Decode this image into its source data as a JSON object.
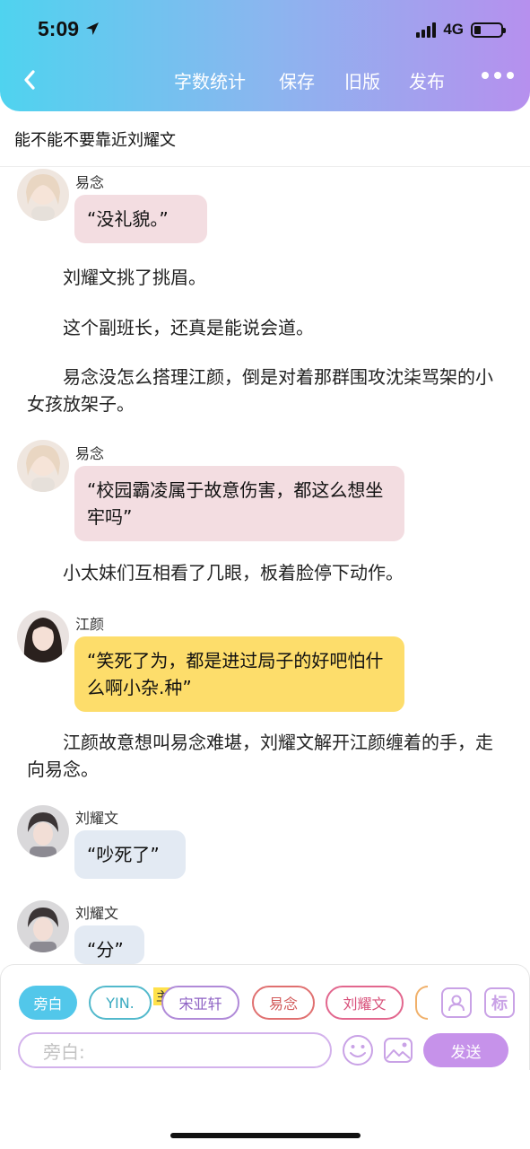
{
  "status_bar": {
    "time": "5:09",
    "network": "4G"
  },
  "nav": {
    "items": [
      "字数统计",
      "保存",
      "旧版",
      "发布"
    ]
  },
  "chapter_title": "能不能不要靠近刘耀文",
  "content": {
    "b1_speaker": "易念",
    "b1_text": "“没礼貌。”",
    "n1": "刘耀文挑了挑眉。",
    "n2": "这个副班长，还真是能说会道。",
    "n3": "易念没怎么搭理江颜，倒是对着那群围攻沈柒骂架的小女孩放架子。",
    "b2_speaker": "易念",
    "b2_text": "“校园霸凌属于故意伤害，都这么想坐牢吗”",
    "n4": "小太妹们互相看了几眼，板着脸停下动作。",
    "b3_speaker": "江颜",
    "b3_text": "“笑死了为，都是进过局子的好吧怕什么啊小杂.种”",
    "n5": "江颜故意想叫易念难堪，刘耀文解开江颜缠着的手，走向易念。",
    "b4_speaker": "刘耀文",
    "b4_text": "“吵死了”",
    "b5_speaker": "刘耀文",
    "b5_text": "“分”"
  },
  "composer": {
    "chips": [
      "旁白",
      "YIN.",
      "宋亚轩",
      "易念",
      "刘耀文"
    ],
    "main_badge": "主",
    "tag_button": "标",
    "input_placeholder": "旁白:",
    "send_label": "发送"
  },
  "colors": {
    "pink_bubble": "#f3dde1",
    "yellow_bubble": "#fddd6b",
    "blue_bubble": "#e3eaf3",
    "accent_purple": "#c692ea",
    "chip_active": "#52c7ea"
  }
}
